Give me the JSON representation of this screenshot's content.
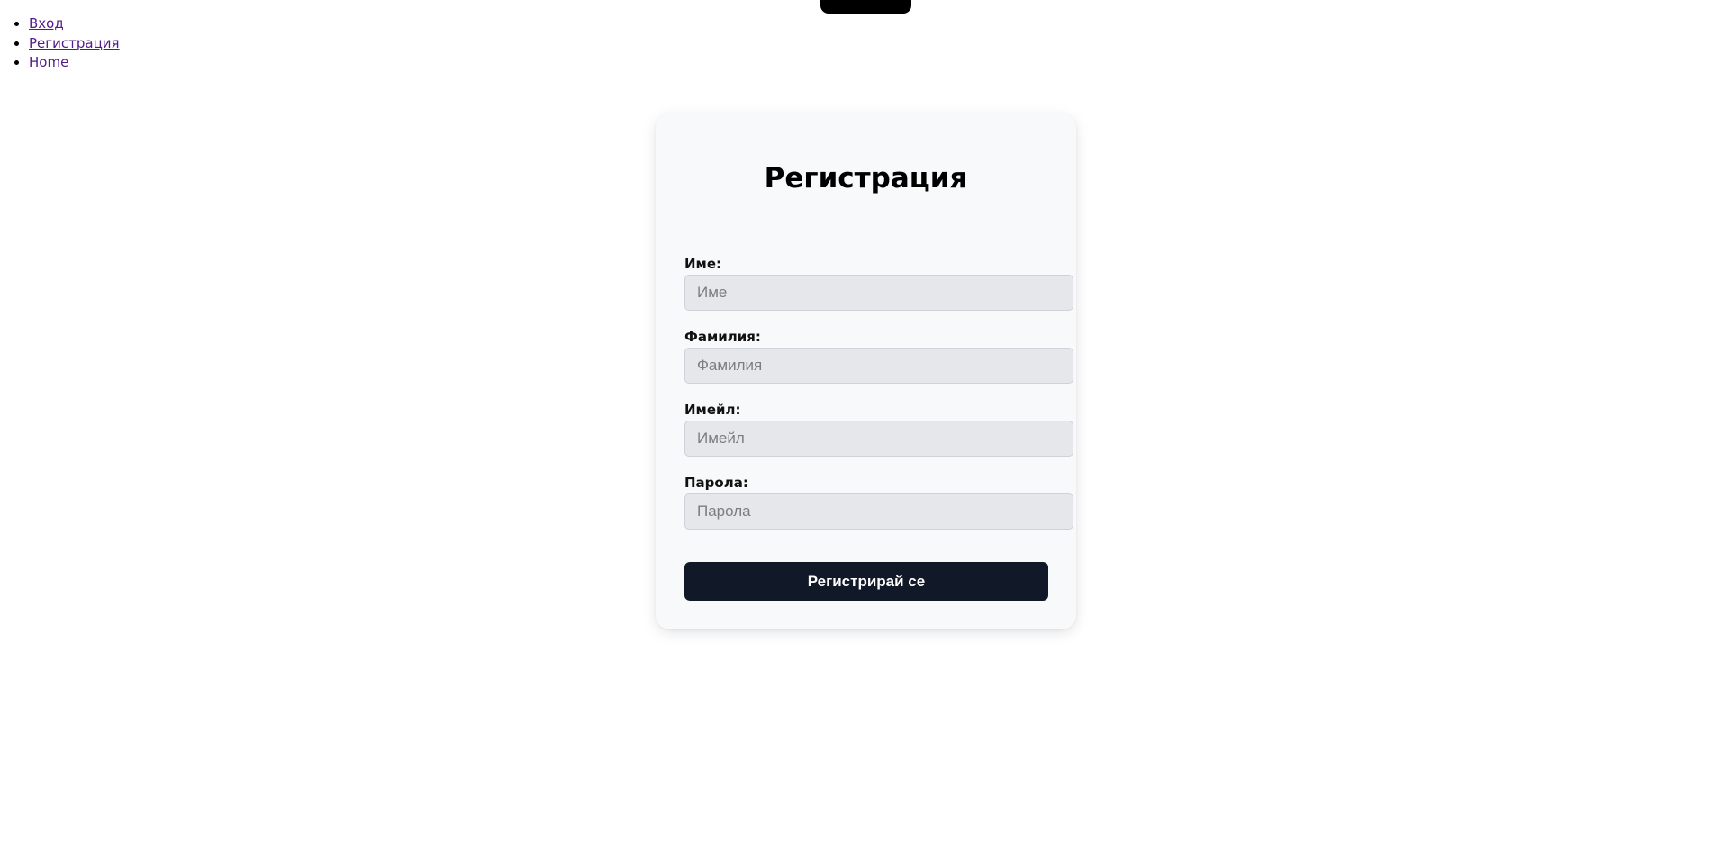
{
  "nav": {
    "items": [
      {
        "label": "Вход"
      },
      {
        "label": "Регистрация"
      },
      {
        "label": "Home"
      }
    ]
  },
  "form": {
    "title": "Регистрация",
    "fields": [
      {
        "label": "Име:",
        "placeholder": "Име",
        "value": ""
      },
      {
        "label": "Фамилия:",
        "placeholder": "Фамилия",
        "value": ""
      },
      {
        "label": "Имейл:",
        "placeholder": "Имейл",
        "value": ""
      },
      {
        "label": "Парола:",
        "placeholder": "Парола",
        "value": ""
      }
    ],
    "submit_label": "Регистрирай се"
  },
  "colors": {
    "link": "#551a8b",
    "card_background": "#f8f9fa",
    "input_background": "#e5e7eb",
    "button_background": "#111827",
    "button_text": "#ffffff"
  }
}
